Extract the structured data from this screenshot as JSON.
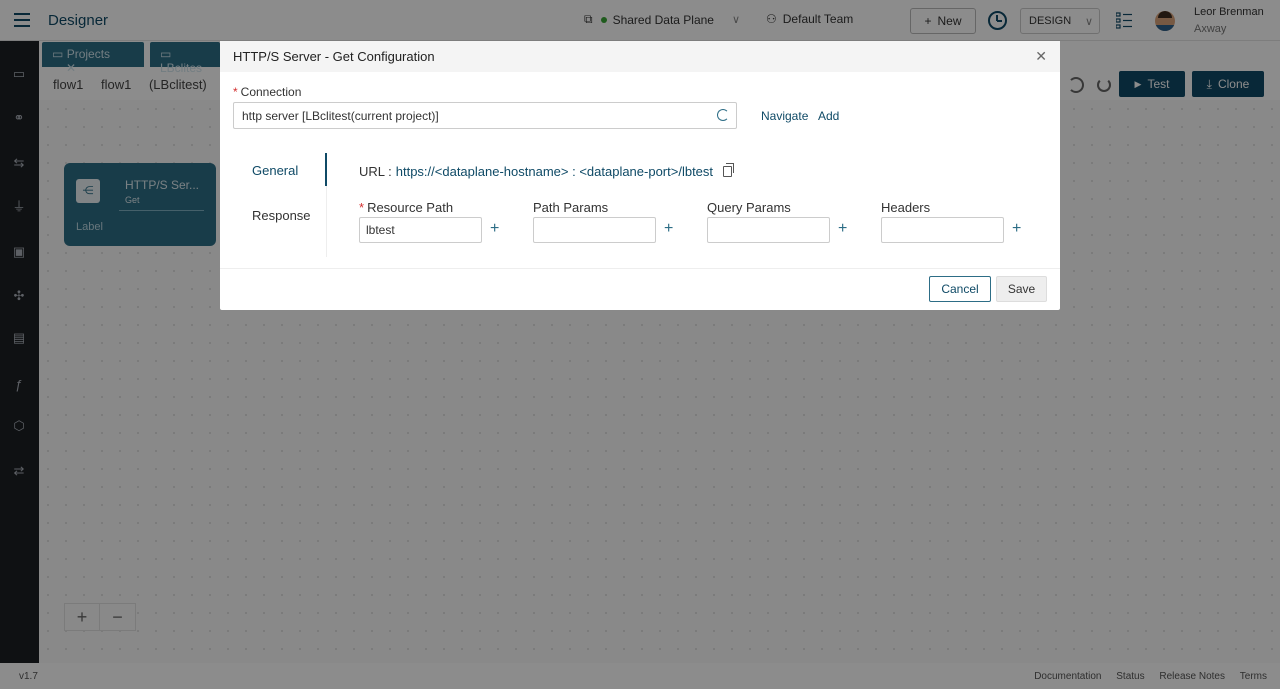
{
  "app": {
    "title": "Designer",
    "dataplane": "Shared Data Plane",
    "team": "Default Team",
    "new_label": "New",
    "mode": "DESIGN",
    "user_name": "Leor Brenman",
    "user_org": "Axway"
  },
  "tabs": [
    {
      "label": "Projects"
    },
    {
      "label": "LBclites"
    }
  ],
  "breadcrumb": [
    "flow1",
    "flow1",
    "(LBclitest)"
  ],
  "toolbar": {
    "test_label": "Test",
    "clone_label": "Clone"
  },
  "node": {
    "title": "HTTP/S Ser...",
    "subtitle": "Get",
    "label": "Label"
  },
  "footer": {
    "version": "v1.7",
    "links": [
      "Documentation",
      "Status",
      "Release Notes",
      "Terms"
    ]
  },
  "modal": {
    "title": "HTTP/S Server - Get Configuration",
    "connection_label": "Connection",
    "connection_value": "http server [LBclitest(current project)]",
    "navigate_label": "Navigate",
    "add_label": "Add",
    "side_tabs": [
      "General",
      "Response"
    ],
    "url_label": "URL :",
    "url_value": "https://<dataplane-hostname> : <dataplane-port>/lbtest",
    "fields": [
      {
        "label": "Resource Path",
        "value": "lbtest",
        "required": true
      },
      {
        "label": "Path Params",
        "value": "",
        "required": false
      },
      {
        "label": "Query Params",
        "value": "",
        "required": false
      },
      {
        "label": "Headers",
        "value": "",
        "required": false
      }
    ],
    "cancel_label": "Cancel",
    "save_label": "Save"
  },
  "colors": {
    "brand": "#0f4a66",
    "node": "#2d6d86",
    "required": "#d32f2f"
  }
}
